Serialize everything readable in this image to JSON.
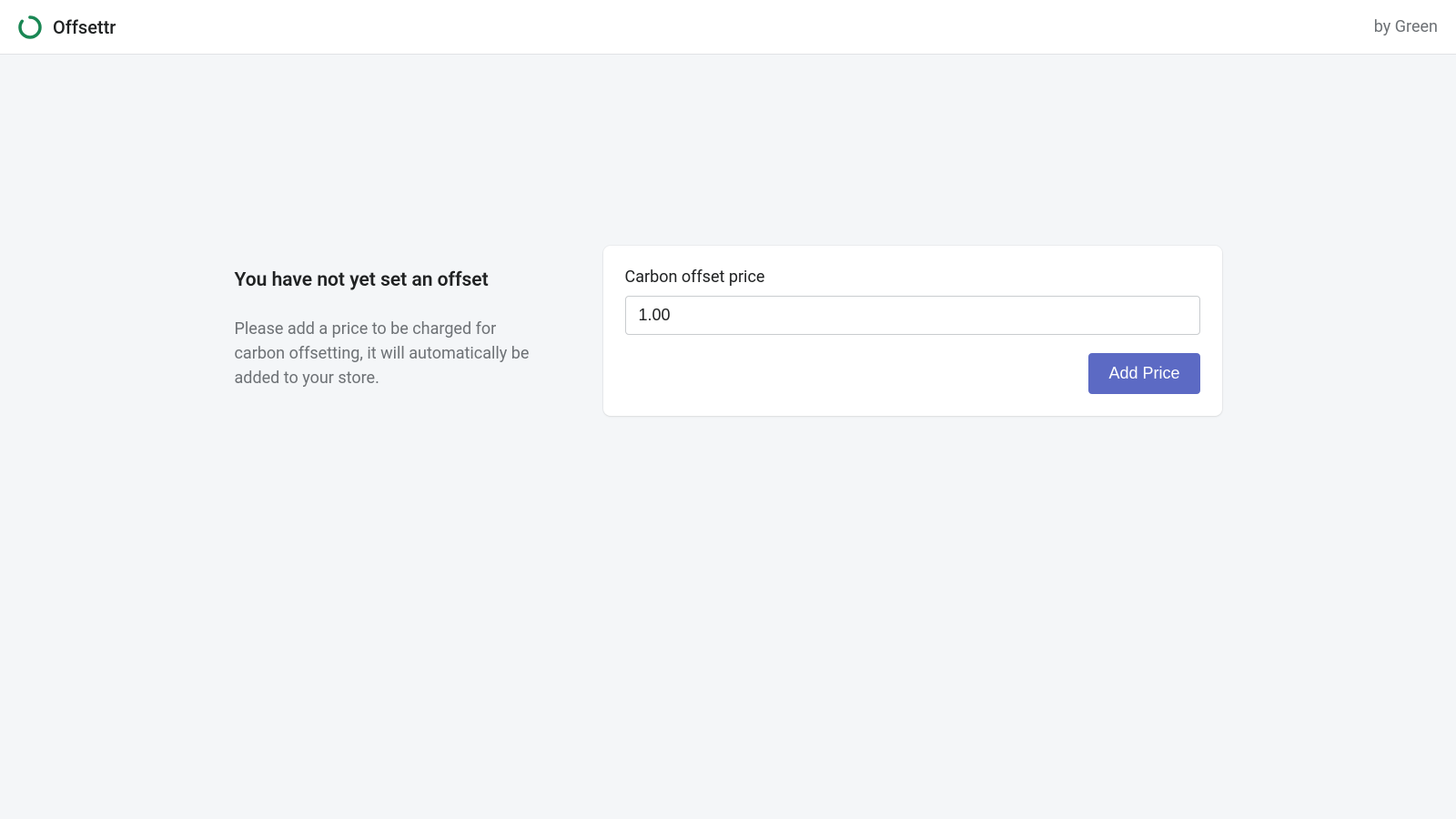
{
  "header": {
    "app_name": "Offsettr",
    "byline": "by Green"
  },
  "main": {
    "heading": "You have not yet set an offset",
    "description": "Please add a price to be charged for carbon offsetting, it will automatically be added to your store."
  },
  "form": {
    "price_label": "Carbon offset price",
    "price_value": "1.00",
    "submit_label": "Add Price"
  },
  "colors": {
    "primary": "#5c6ac4",
    "logo_green": "#2e8b57",
    "background": "#f4f6f8",
    "text_primary": "#202223",
    "text_secondary": "#6d7175"
  }
}
